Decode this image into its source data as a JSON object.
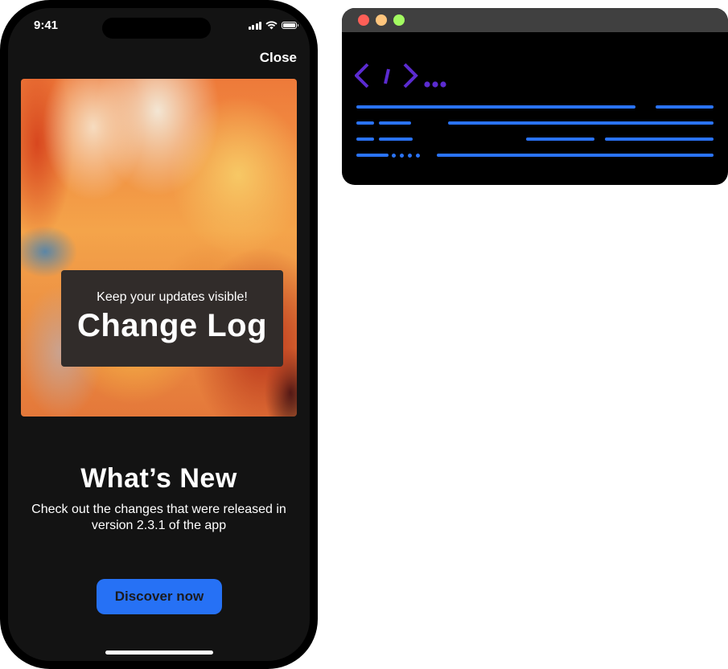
{
  "phone": {
    "status_bar": {
      "time": "9:41",
      "icons": [
        "cellular-signal-icon",
        "wifi-icon",
        "battery-icon"
      ]
    },
    "close_label": "Close",
    "hero_card": {
      "subtitle": "Keep your updates visible!",
      "title": "Change Log"
    },
    "headline": "What’s New",
    "description": "Check out the changes that were released in version 2.3.1 of the app",
    "cta_label": "Discover now",
    "colors": {
      "background": "#131313",
      "accent": "#2671F5",
      "card": "#312C2A"
    }
  },
  "code_window": {
    "traffic_lights": [
      "#FE5F57",
      "#FEC57D",
      "#A3FB61"
    ],
    "glyph": "code-brackets-icon",
    "glyph_color": "#5B2BD0",
    "line_color": "#2A73F8"
  }
}
